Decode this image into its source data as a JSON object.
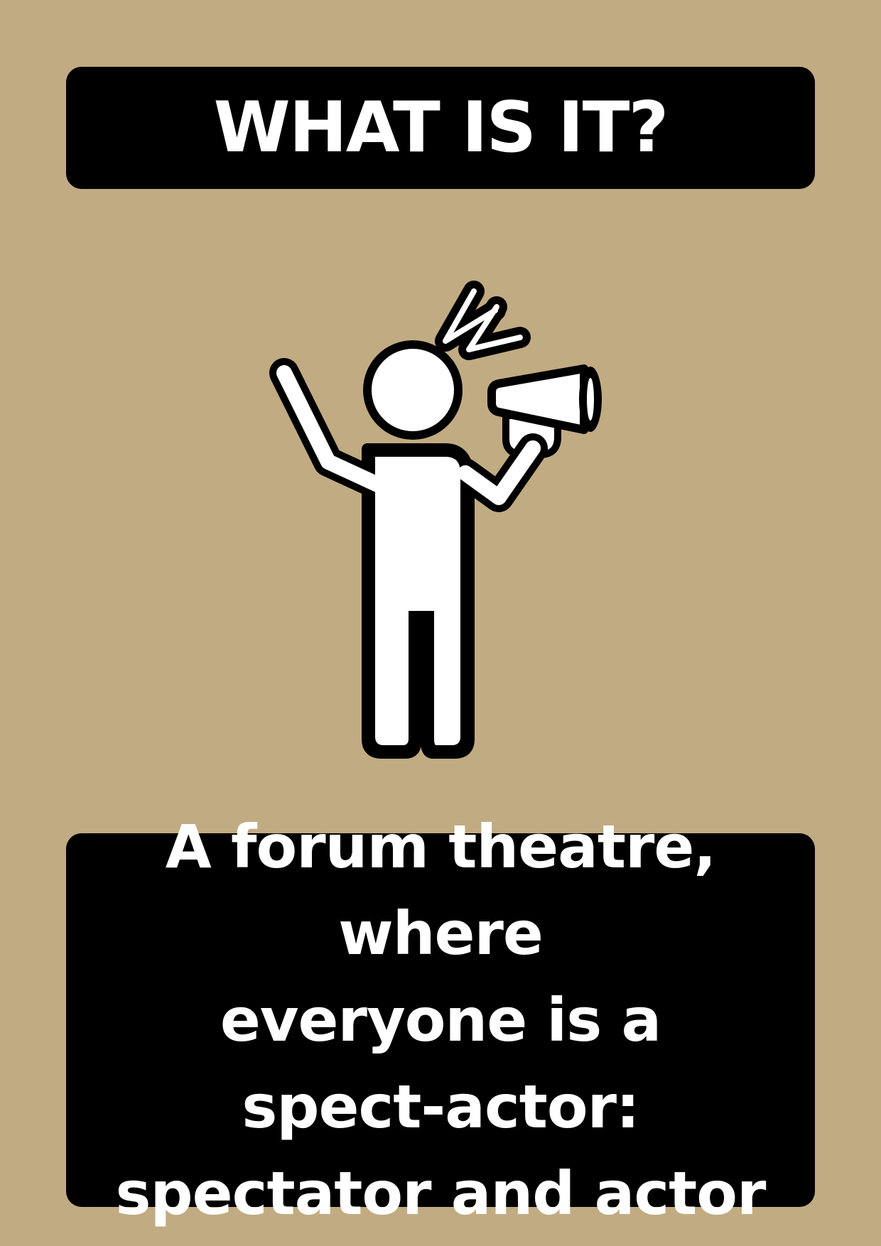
{
  "title": "WHAT IS IT?",
  "description": {
    "line1": "A forum theatre, where",
    "line2": "everyone is a",
    "line3": "spect-actor:",
    "line4": "spectator and actor"
  },
  "illustration": {
    "icon": "person-with-megaphone-icon"
  },
  "colors": {
    "background": "#c1ab82",
    "card": "#000000",
    "text": "#ffffff"
  }
}
